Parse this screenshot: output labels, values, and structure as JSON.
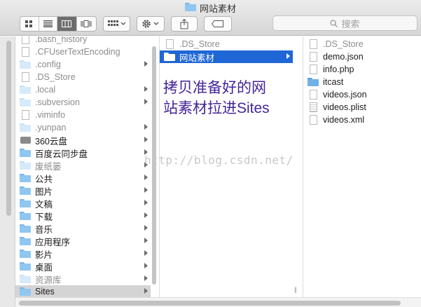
{
  "window": {
    "title": "网站素材"
  },
  "toolbar": {
    "view_icons": [
      "icon-view-icon",
      "list-view-icon",
      "column-view-icon",
      "cover-flow-view-icon"
    ],
    "arrange_icon": "arrange-grid-icon",
    "action_icon": "gear-icon",
    "share_icon": "share-icon",
    "tag_icon": "tag-icon"
  },
  "search": {
    "placeholder": "搜索"
  },
  "columns": {
    "col1": [
      {
        "label": ".bash_history",
        "icon": "doc",
        "dim": true,
        "arrow": false
      },
      {
        "label": ".CFUserTextEncoding",
        "icon": "doc",
        "dim": true,
        "arrow": false
      },
      {
        "label": ".config",
        "icon": "folder-faded",
        "dim": true,
        "arrow": true
      },
      {
        "label": ".DS_Store",
        "icon": "doc",
        "dim": true,
        "arrow": false
      },
      {
        "label": ".local",
        "icon": "folder-faded",
        "dim": true,
        "arrow": true
      },
      {
        "label": ".subversion",
        "icon": "folder-faded",
        "dim": true,
        "arrow": true
      },
      {
        "label": ".viminfo",
        "icon": "doc",
        "dim": true,
        "arrow": false
      },
      {
        "label": ".yunpan",
        "icon": "folder-faded",
        "dim": true,
        "arrow": true
      },
      {
        "label": "360云盘",
        "icon": "drive",
        "dim": false,
        "arrow": true
      },
      {
        "label": "百度云同步盘",
        "icon": "folder",
        "dim": false,
        "arrow": true
      },
      {
        "label": "废纸篓",
        "icon": "folder-faded",
        "dim": true,
        "arrow": true
      },
      {
        "label": "公共",
        "icon": "folder",
        "dim": false,
        "arrow": true
      },
      {
        "label": "图片",
        "icon": "folder",
        "dim": false,
        "arrow": true
      },
      {
        "label": "文稿",
        "icon": "folder",
        "dim": false,
        "arrow": true
      },
      {
        "label": "下载",
        "icon": "folder",
        "dim": false,
        "arrow": true
      },
      {
        "label": "音乐",
        "icon": "folder",
        "dim": false,
        "arrow": true
      },
      {
        "label": "应用程序",
        "icon": "folder",
        "dim": false,
        "arrow": true
      },
      {
        "label": "影片",
        "icon": "folder",
        "dim": false,
        "arrow": true
      },
      {
        "label": "桌面",
        "icon": "folder",
        "dim": false,
        "arrow": true
      },
      {
        "label": "资源库",
        "icon": "folder-faded",
        "dim": true,
        "arrow": true
      },
      {
        "label": "Sites",
        "icon": "folder",
        "dim": false,
        "arrow": true,
        "selected": "gray"
      }
    ],
    "col2": [
      {
        "label": ".DS_Store",
        "icon": "doc",
        "dim": true,
        "arrow": false
      },
      {
        "label": "网站素材",
        "icon": "folder-white",
        "dim": false,
        "arrow": true,
        "selected": "blue"
      }
    ],
    "col3": [
      {
        "label": ".DS_Store",
        "icon": "doc",
        "dim": true,
        "arrow": false
      },
      {
        "label": "demo.json",
        "icon": "doc",
        "dim": false,
        "arrow": false
      },
      {
        "label": "info.php",
        "icon": "doc",
        "dim": false,
        "arrow": false
      },
      {
        "label": "itcast",
        "icon": "folder-dark",
        "dim": false,
        "arrow": false
      },
      {
        "label": "videos.json",
        "icon": "doc",
        "dim": false,
        "arrow": false
      },
      {
        "label": "videos.plist",
        "icon": "doc-lines",
        "dim": false,
        "arrow": false
      },
      {
        "label": "videos.xml",
        "icon": "doc",
        "dim": false,
        "arrow": false
      }
    ]
  },
  "annotation": {
    "line1": "拷贝准备好的网",
    "line2": "站素材拉进Sites"
  },
  "watermark": "http://blog.csdn.net/",
  "colors": {
    "selection": "#1f66d6",
    "annotation": "#44249a"
  }
}
